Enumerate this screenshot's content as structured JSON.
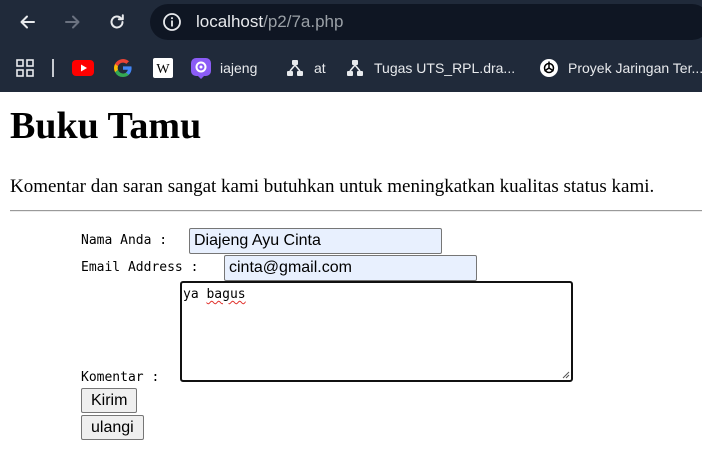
{
  "browser": {
    "url_host": "localhost",
    "url_path": "/p2/7a.php",
    "nav_icons": [
      "back-arrow-icon",
      "forward-arrow-icon",
      "reload-icon",
      "site-info-icon"
    ]
  },
  "bookmarks": [
    {
      "icon": "apps-grid-icon",
      "label": ""
    },
    {
      "icon": "youtube-icon",
      "label": ""
    },
    {
      "icon": "google-icon",
      "label": ""
    },
    {
      "icon": "wikipedia-icon",
      "label": ""
    },
    {
      "icon": "canva-icon",
      "label": "iajeng"
    },
    {
      "icon": "drawio-icon",
      "label": "at"
    },
    {
      "icon": "drawio-icon",
      "label": "Tugas UTS_RPL.dra..."
    },
    {
      "icon": "openai-icon",
      "label": "Proyek Jaringan Ter..."
    }
  ],
  "page": {
    "title": "Buku Tamu",
    "intro": "Komentar dan saran sangat kami butuhkan untuk meningkatkan kualitas status kami."
  },
  "form": {
    "name_label": "Nama Anda :",
    "name_value": "Diajeng Ayu Cinta",
    "email_label": "Email Address :",
    "email_value": "cinta@gmail.com",
    "comment_label": "Komentar :",
    "comment_word1": "ya",
    "comment_word2": "bagus",
    "submit_label": "Kirim",
    "reset_label": "ulangi"
  },
  "colors": {
    "chrome_bg": "#202a3a",
    "omnibox_bg": "#0f1623",
    "autofill_bg": "#e8f0fe",
    "youtube_red": "#ff0000"
  }
}
